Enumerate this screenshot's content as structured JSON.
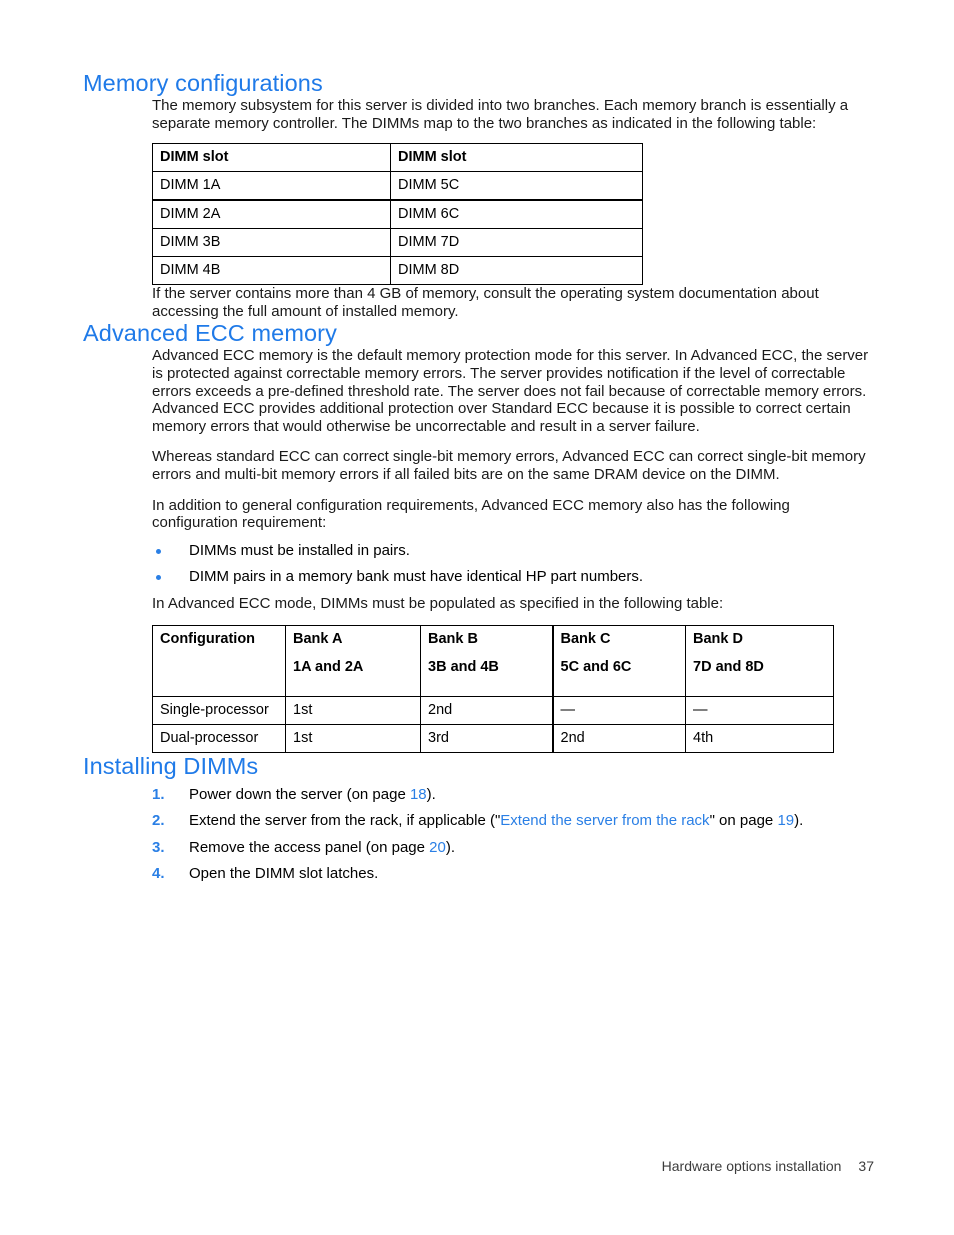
{
  "sections": {
    "memory_configurations": {
      "heading": "Memory configurations",
      "intro": "The memory subsystem for this server is divided into two branches. Each memory branch is essentially a separate memory controller. The DIMMs map to the two branches as indicated in the following table:",
      "after_table": "If the server contains more than 4 GB of memory, consult the operating system documentation about accessing the full amount of installed memory."
    },
    "advanced_ecc": {
      "heading": "Advanced ECC memory",
      "para1": "Advanced ECC memory is the default memory protection mode for this server. In Advanced ECC, the server is protected against correctable memory errors. The server provides notification if the level of correctable errors exceeds a pre-defined threshold rate. The server does not fail because of correctable memory errors. Advanced ECC provides additional protection over Standard ECC because it is possible to correct certain memory errors that would otherwise be uncorrectable and result in a server failure.",
      "para2": "Whereas standard ECC can correct single-bit memory errors, Advanced ECC can correct single-bit memory errors and multi-bit memory errors if all failed bits are on the same DRAM device on the DIMM.",
      "para3": "In addition to general configuration requirements, Advanced ECC memory also has the following configuration requirement:",
      "bullets": [
        "DIMMs must be installed in pairs.",
        "DIMM pairs in a memory bank must have identical HP part numbers."
      ],
      "before_table": "In Advanced ECC mode, DIMMs must be populated as specified in the following table:"
    },
    "installing_dimms": {
      "heading": "Installing DIMMs",
      "steps": [
        {
          "number": "1.",
          "pre": "Power down the server (on page ",
          "link": "",
          "mid": "",
          "page": "18",
          "post": ")."
        },
        {
          "number": "2.",
          "pre": "Extend the server from the rack, if applicable (\"",
          "link": "Extend the server from the rack",
          "mid": "\" on page ",
          "page": "19",
          "post": ")."
        },
        {
          "number": "3.",
          "pre": "Remove the access panel (on page ",
          "link": "",
          "mid": "",
          "page": "20",
          "post": ")."
        },
        {
          "number": "4.",
          "pre": "Open the DIMM slot latches.",
          "link": "",
          "mid": "",
          "page": "",
          "post": ""
        }
      ]
    }
  },
  "tables": {
    "dimm_slots": {
      "headers": [
        "DIMM slot",
        "DIMM slot"
      ],
      "rows": [
        [
          "DIMM 1A",
          "DIMM 5C"
        ],
        [
          "DIMM 2A",
          "DIMM 6C"
        ],
        [
          "DIMM 3B",
          "DIMM 7D"
        ],
        [
          "DIMM 4B",
          "DIMM 8D"
        ]
      ]
    },
    "advanced_ecc_population": {
      "headers": [
        {
          "title": "Configuration",
          "sub": ""
        },
        {
          "title": "Bank A",
          "sub": "1A and 2A"
        },
        {
          "title": "Bank B",
          "sub": "3B and 4B"
        },
        {
          "title": "Bank C",
          "sub": "5C and 6C"
        },
        {
          "title": "Bank D",
          "sub": "7D and 8D"
        }
      ],
      "rows": [
        [
          "Single-processor",
          "1st",
          "2nd",
          "—",
          "—"
        ],
        [
          "Dual-processor",
          "1st",
          "3rd",
          "2nd",
          "4th"
        ]
      ]
    }
  },
  "footer": {
    "label": "Hardware options installation",
    "page_number": "37"
  },
  "colors": {
    "heading_blue": "#1f7ae8",
    "accent_blue": "#2a7fe5",
    "text_black": "#1a1a1a",
    "table_border": "#000000"
  }
}
